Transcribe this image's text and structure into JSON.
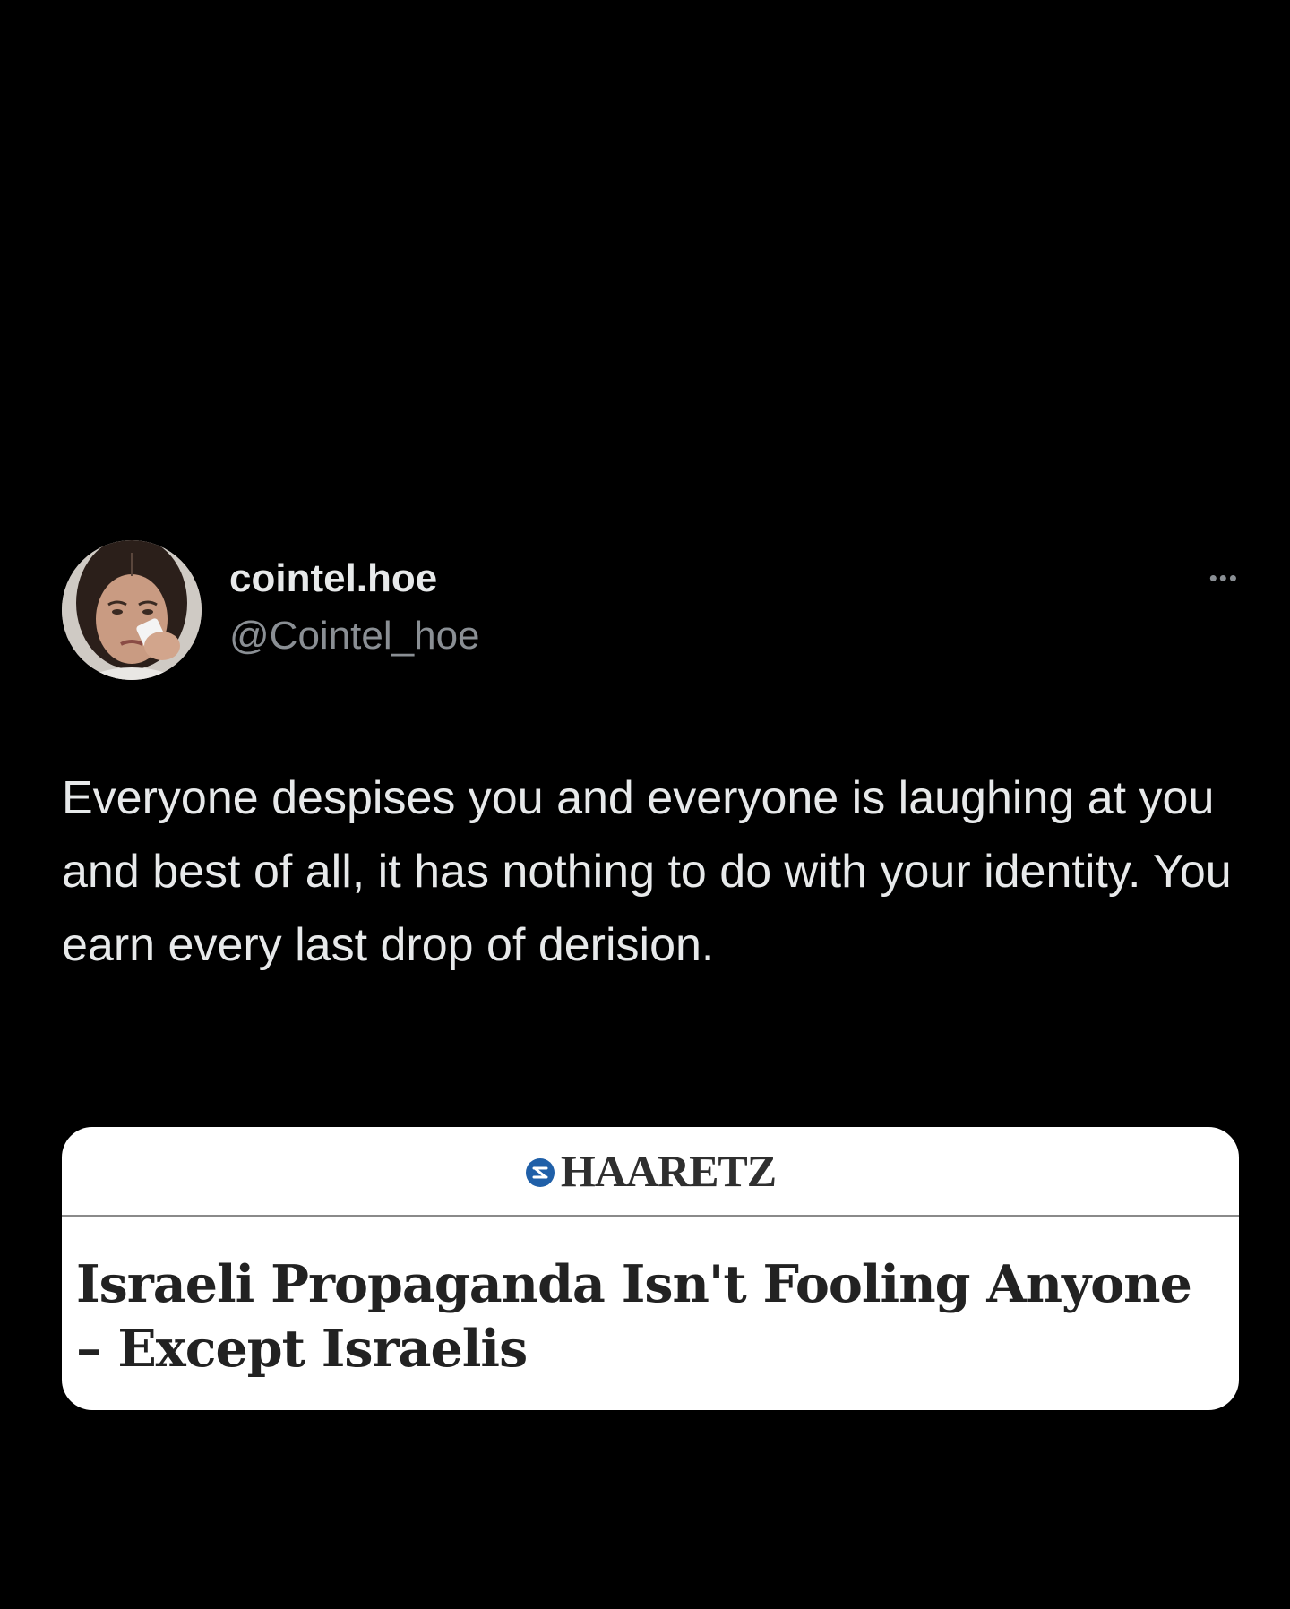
{
  "tweet": {
    "display_name": "cointel.hoe",
    "handle": "@Cointel_hoe",
    "more_label": "•••",
    "text": "Everyone despises you and everyone is laughing at you and best of all, it has nothing to do with your identity. You earn every last drop of derision."
  },
  "link_card": {
    "source": "HAARETZ",
    "headline": "Israeli Propaganda Isn't Fooling Anyone – Except Israelis",
    "logo_icon": "haaretz-logo-icon"
  },
  "colors": {
    "background": "#000000",
    "text_primary": "#e7e9ea",
    "text_secondary": "#8a8f94",
    "card_background": "#ffffff",
    "card_logo_blue": "#1f5fa8"
  }
}
